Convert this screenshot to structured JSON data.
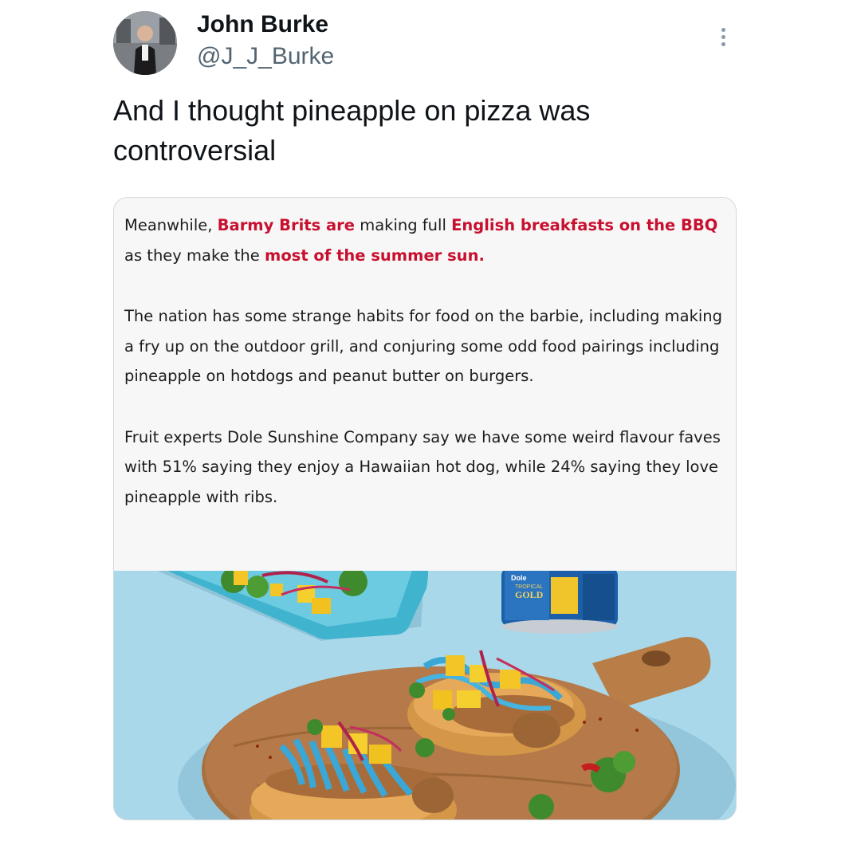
{
  "author": {
    "display_name": "John Burke",
    "handle": "@J_J_Burke",
    "avatar_icon": "user-photo-avatar"
  },
  "menu": {
    "icon": "more-vertical-icon"
  },
  "tweet": {
    "text": "And I thought pineapple on pizza was controversial"
  },
  "article": {
    "p1": {
      "s1": "Meanwhile, ",
      "h1": "Barmy Brits are",
      "s2": " making full ",
      "h2": "English breakfasts on the BBQ",
      "s3": " as they make the ",
      "h3": "most of the summer sun."
    },
    "p2": "The nation has some strange habits for food on the barbie, including making a fry up on the outdoor grill, and conjuring some odd food pairings including pineapple on hotdogs and peanut butter on burgers.",
    "p3": "Fruit experts Dole Sunshine Company say we have some weird flavour faves with 51% saying they enjoy a Hawaiian hot dog, while 24% saying they love pineapple with ribs.",
    "highlight_color": "#c8102e"
  },
  "photo": {
    "can_brand": "Dole",
    "can_line1": "TROPICAL",
    "can_line2": "GOLD",
    "background_color": "#a9d8ea"
  }
}
